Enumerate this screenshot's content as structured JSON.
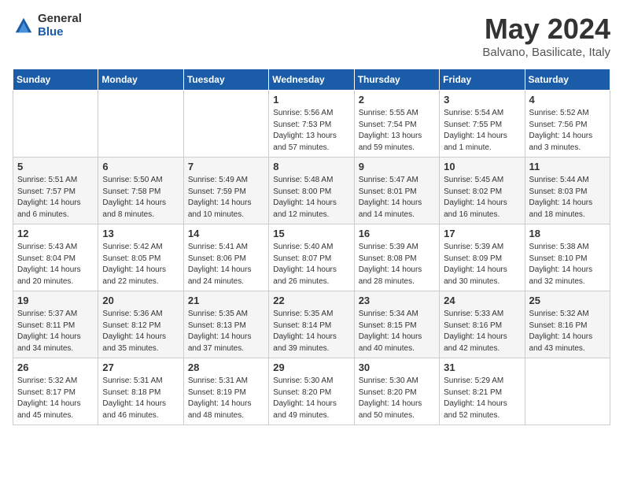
{
  "logo": {
    "general": "General",
    "blue": "Blue"
  },
  "title": "May 2024",
  "subtitle": "Balvano, Basilicate, Italy",
  "headers": [
    "Sunday",
    "Monday",
    "Tuesday",
    "Wednesday",
    "Thursday",
    "Friday",
    "Saturday"
  ],
  "weeks": [
    [
      {
        "day": "",
        "info": ""
      },
      {
        "day": "",
        "info": ""
      },
      {
        "day": "",
        "info": ""
      },
      {
        "day": "1",
        "info": "Sunrise: 5:56 AM\nSunset: 7:53 PM\nDaylight: 13 hours\nand 57 minutes."
      },
      {
        "day": "2",
        "info": "Sunrise: 5:55 AM\nSunset: 7:54 PM\nDaylight: 13 hours\nand 59 minutes."
      },
      {
        "day": "3",
        "info": "Sunrise: 5:54 AM\nSunset: 7:55 PM\nDaylight: 14 hours\nand 1 minute."
      },
      {
        "day": "4",
        "info": "Sunrise: 5:52 AM\nSunset: 7:56 PM\nDaylight: 14 hours\nand 3 minutes."
      }
    ],
    [
      {
        "day": "5",
        "info": "Sunrise: 5:51 AM\nSunset: 7:57 PM\nDaylight: 14 hours\nand 6 minutes."
      },
      {
        "day": "6",
        "info": "Sunrise: 5:50 AM\nSunset: 7:58 PM\nDaylight: 14 hours\nand 8 minutes."
      },
      {
        "day": "7",
        "info": "Sunrise: 5:49 AM\nSunset: 7:59 PM\nDaylight: 14 hours\nand 10 minutes."
      },
      {
        "day": "8",
        "info": "Sunrise: 5:48 AM\nSunset: 8:00 PM\nDaylight: 14 hours\nand 12 minutes."
      },
      {
        "day": "9",
        "info": "Sunrise: 5:47 AM\nSunset: 8:01 PM\nDaylight: 14 hours\nand 14 minutes."
      },
      {
        "day": "10",
        "info": "Sunrise: 5:45 AM\nSunset: 8:02 PM\nDaylight: 14 hours\nand 16 minutes."
      },
      {
        "day": "11",
        "info": "Sunrise: 5:44 AM\nSunset: 8:03 PM\nDaylight: 14 hours\nand 18 minutes."
      }
    ],
    [
      {
        "day": "12",
        "info": "Sunrise: 5:43 AM\nSunset: 8:04 PM\nDaylight: 14 hours\nand 20 minutes."
      },
      {
        "day": "13",
        "info": "Sunrise: 5:42 AM\nSunset: 8:05 PM\nDaylight: 14 hours\nand 22 minutes."
      },
      {
        "day": "14",
        "info": "Sunrise: 5:41 AM\nSunset: 8:06 PM\nDaylight: 14 hours\nand 24 minutes."
      },
      {
        "day": "15",
        "info": "Sunrise: 5:40 AM\nSunset: 8:07 PM\nDaylight: 14 hours\nand 26 minutes."
      },
      {
        "day": "16",
        "info": "Sunrise: 5:39 AM\nSunset: 8:08 PM\nDaylight: 14 hours\nand 28 minutes."
      },
      {
        "day": "17",
        "info": "Sunrise: 5:39 AM\nSunset: 8:09 PM\nDaylight: 14 hours\nand 30 minutes."
      },
      {
        "day": "18",
        "info": "Sunrise: 5:38 AM\nSunset: 8:10 PM\nDaylight: 14 hours\nand 32 minutes."
      }
    ],
    [
      {
        "day": "19",
        "info": "Sunrise: 5:37 AM\nSunset: 8:11 PM\nDaylight: 14 hours\nand 34 minutes."
      },
      {
        "day": "20",
        "info": "Sunrise: 5:36 AM\nSunset: 8:12 PM\nDaylight: 14 hours\nand 35 minutes."
      },
      {
        "day": "21",
        "info": "Sunrise: 5:35 AM\nSunset: 8:13 PM\nDaylight: 14 hours\nand 37 minutes."
      },
      {
        "day": "22",
        "info": "Sunrise: 5:35 AM\nSunset: 8:14 PM\nDaylight: 14 hours\nand 39 minutes."
      },
      {
        "day": "23",
        "info": "Sunrise: 5:34 AM\nSunset: 8:15 PM\nDaylight: 14 hours\nand 40 minutes."
      },
      {
        "day": "24",
        "info": "Sunrise: 5:33 AM\nSunset: 8:16 PM\nDaylight: 14 hours\nand 42 minutes."
      },
      {
        "day": "25",
        "info": "Sunrise: 5:32 AM\nSunset: 8:16 PM\nDaylight: 14 hours\nand 43 minutes."
      }
    ],
    [
      {
        "day": "26",
        "info": "Sunrise: 5:32 AM\nSunset: 8:17 PM\nDaylight: 14 hours\nand 45 minutes."
      },
      {
        "day": "27",
        "info": "Sunrise: 5:31 AM\nSunset: 8:18 PM\nDaylight: 14 hours\nand 46 minutes."
      },
      {
        "day": "28",
        "info": "Sunrise: 5:31 AM\nSunset: 8:19 PM\nDaylight: 14 hours\nand 48 minutes."
      },
      {
        "day": "29",
        "info": "Sunrise: 5:30 AM\nSunset: 8:20 PM\nDaylight: 14 hours\nand 49 minutes."
      },
      {
        "day": "30",
        "info": "Sunrise: 5:30 AM\nSunset: 8:20 PM\nDaylight: 14 hours\nand 50 minutes."
      },
      {
        "day": "31",
        "info": "Sunrise: 5:29 AM\nSunset: 8:21 PM\nDaylight: 14 hours\nand 52 minutes."
      },
      {
        "day": "",
        "info": ""
      }
    ]
  ]
}
